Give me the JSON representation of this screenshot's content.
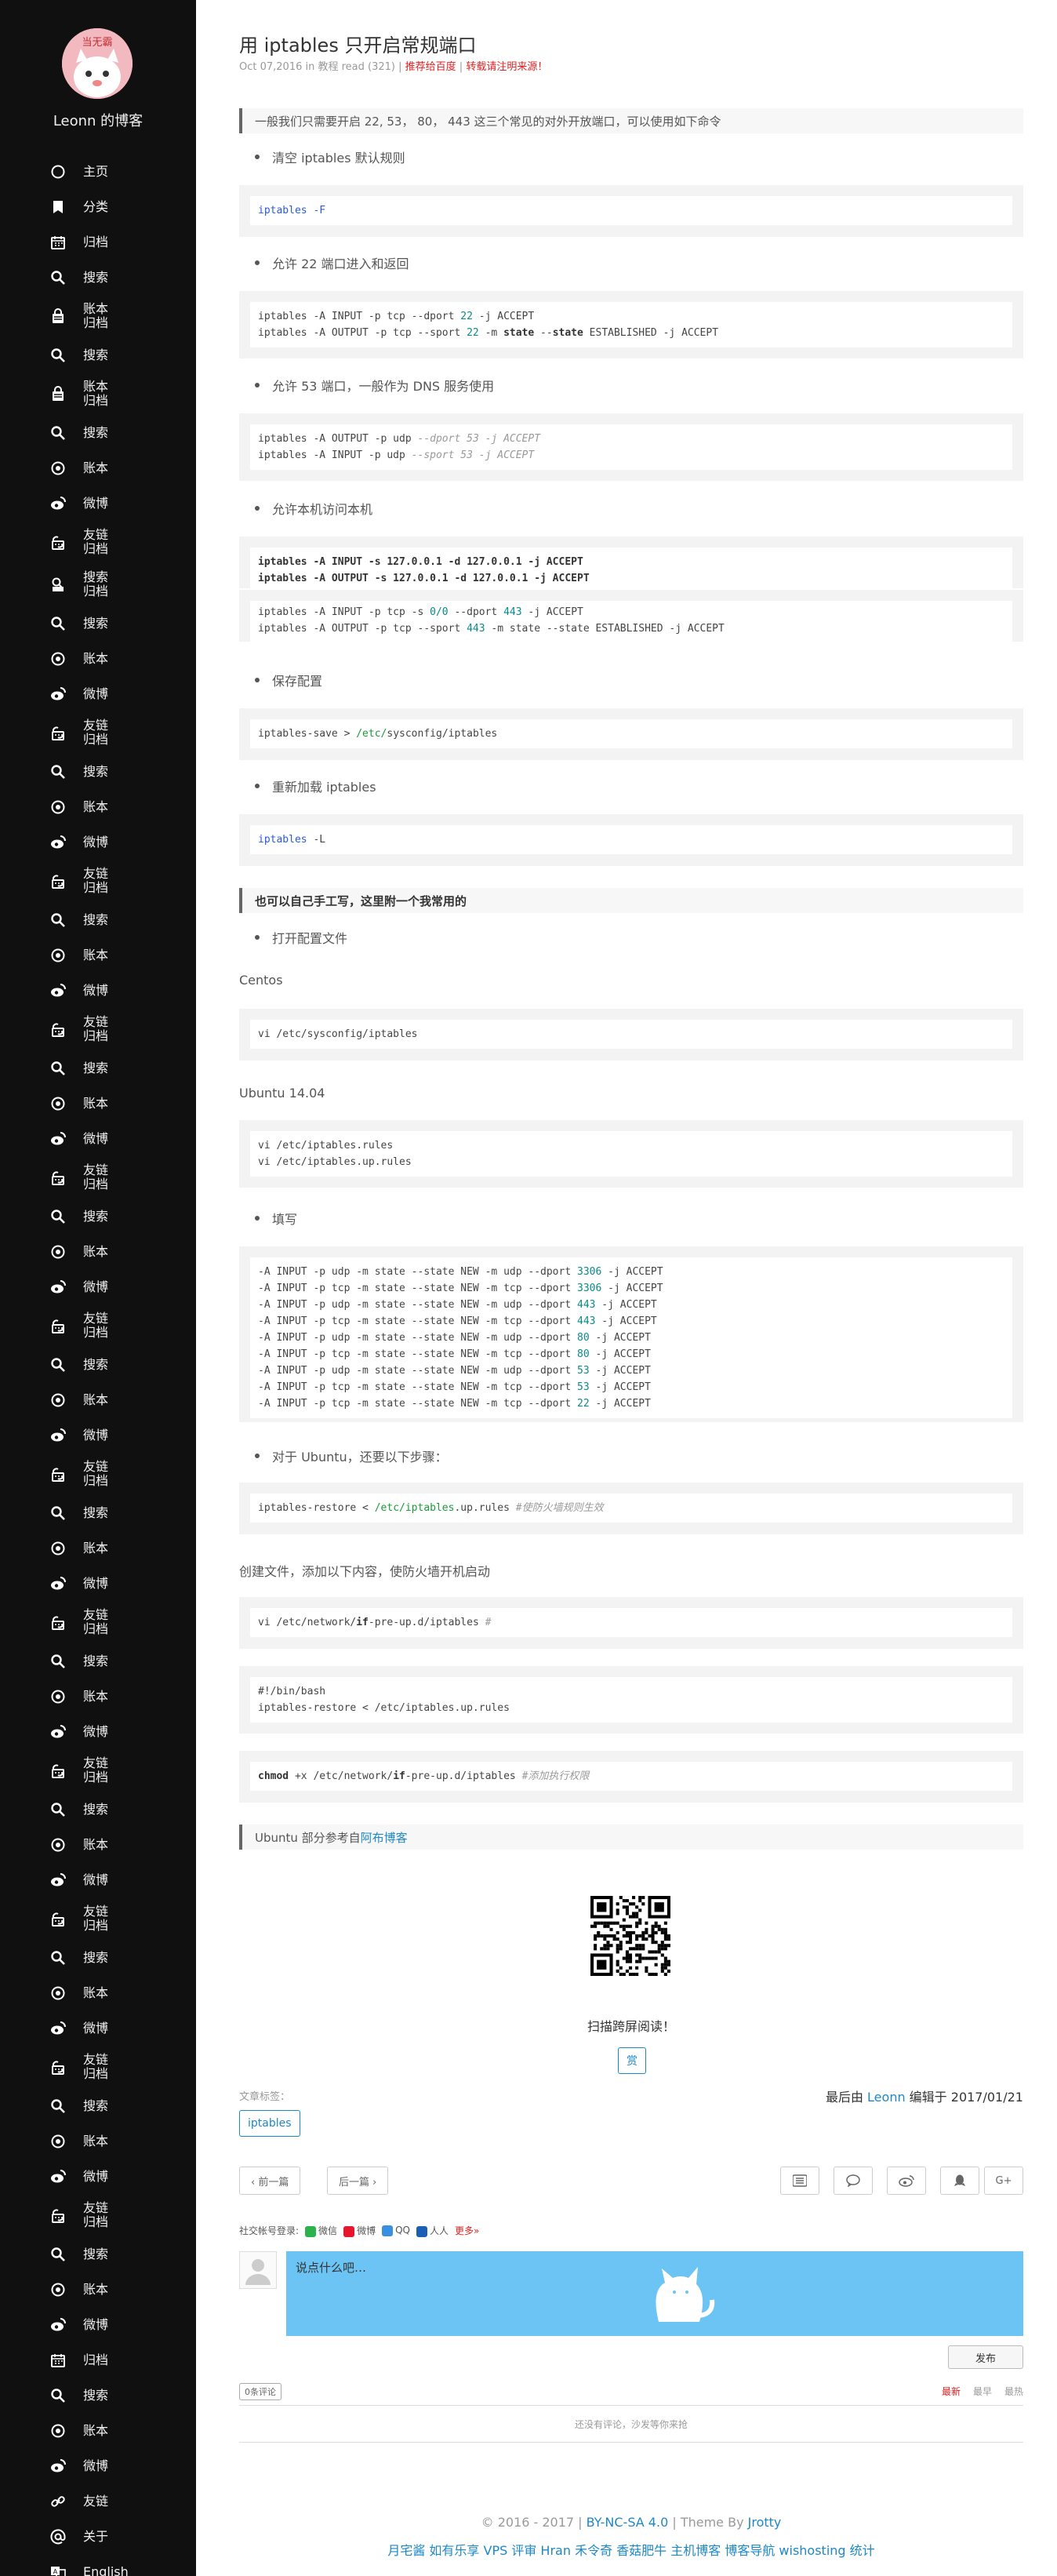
{
  "sidebar": {
    "site_name": "Leonn 的博客",
    "avatar_text": "当无霸",
    "items": [
      {
        "icon": "circle-icon",
        "label": "主页"
      },
      {
        "icon": "bookmark-icon",
        "label": "分类"
      },
      {
        "icon": "calendar-icon",
        "label": "归档"
      },
      {
        "icon": "search-icon",
        "label": "搜索"
      },
      {
        "icon": "lock-calendar-icon",
        "label": "账本\n归档"
      },
      {
        "icon": "search-icon",
        "label": "搜索"
      },
      {
        "icon": "lock-calendar-icon",
        "label": "账本\n归档"
      },
      {
        "icon": "search-icon",
        "label": "搜索"
      },
      {
        "icon": "target-icon",
        "label": "账本"
      },
      {
        "icon": "weibo-icon",
        "label": "微博"
      },
      {
        "icon": "link-calendar-icon",
        "label": "友链\n归档"
      },
      {
        "icon": "search-calendar-icon",
        "label": "搜索\n归档"
      },
      {
        "icon": "search-icon",
        "label": "搜索"
      },
      {
        "icon": "target-icon",
        "label": "账本"
      },
      {
        "icon": "weibo-icon",
        "label": "微博"
      },
      {
        "icon": "link-calendar-icon",
        "label": "友链\n归档"
      },
      {
        "icon": "search-icon",
        "label": "搜索"
      },
      {
        "icon": "target-icon",
        "label": "账本"
      },
      {
        "icon": "weibo-icon",
        "label": "微博"
      },
      {
        "icon": "link-calendar-icon",
        "label": "友链\n归档"
      },
      {
        "icon": "search-icon",
        "label": "搜索"
      },
      {
        "icon": "target-icon",
        "label": "账本"
      },
      {
        "icon": "weibo-icon",
        "label": "微博"
      },
      {
        "icon": "link-calendar-icon",
        "label": "友链\n归档"
      },
      {
        "icon": "search-icon",
        "label": "搜索"
      },
      {
        "icon": "target-icon",
        "label": "账本"
      },
      {
        "icon": "weibo-icon",
        "label": "微博"
      },
      {
        "icon": "link-calendar-icon",
        "label": "友链\n归档"
      },
      {
        "icon": "search-icon",
        "label": "搜索"
      },
      {
        "icon": "target-icon",
        "label": "账本"
      },
      {
        "icon": "weibo-icon",
        "label": "微博"
      },
      {
        "icon": "link-calendar-icon",
        "label": "友链\n归档"
      },
      {
        "icon": "search-icon",
        "label": "搜索"
      },
      {
        "icon": "target-icon",
        "label": "账本"
      },
      {
        "icon": "weibo-icon",
        "label": "微博"
      },
      {
        "icon": "link-calendar-icon",
        "label": "友链\n归档"
      },
      {
        "icon": "search-icon",
        "label": "搜索"
      },
      {
        "icon": "target-icon",
        "label": "账本"
      },
      {
        "icon": "weibo-icon",
        "label": "微博"
      },
      {
        "icon": "link-calendar-icon",
        "label": "友链\n归档"
      },
      {
        "icon": "search-icon",
        "label": "搜索"
      },
      {
        "icon": "target-icon",
        "label": "账本"
      },
      {
        "icon": "weibo-icon",
        "label": "微博"
      },
      {
        "icon": "link-calendar-icon",
        "label": "友链\n归档"
      },
      {
        "icon": "search-icon",
        "label": "搜索"
      },
      {
        "icon": "target-icon",
        "label": "账本"
      },
      {
        "icon": "weibo-icon",
        "label": "微博"
      },
      {
        "icon": "link-calendar-icon",
        "label": "友链\n归档"
      },
      {
        "icon": "search-icon",
        "label": "搜索"
      },
      {
        "icon": "target-icon",
        "label": "账本"
      },
      {
        "icon": "weibo-icon",
        "label": "微博"
      },
      {
        "icon": "link-calendar-icon",
        "label": "友链\n归档"
      },
      {
        "icon": "search-icon",
        "label": "搜索"
      },
      {
        "icon": "target-icon",
        "label": "账本"
      },
      {
        "icon": "weibo-icon",
        "label": "微博"
      },
      {
        "icon": "link-calendar-icon",
        "label": "友链\n归档"
      },
      {
        "icon": "search-icon",
        "label": "搜索"
      },
      {
        "icon": "target-icon",
        "label": "账本"
      },
      {
        "icon": "weibo-icon",
        "label": "微博"
      },
      {
        "icon": "calendar-icon",
        "label": "归档"
      },
      {
        "icon": "search-icon",
        "label": "搜索"
      },
      {
        "icon": "target-icon",
        "label": "账本"
      },
      {
        "icon": "weibo-icon",
        "label": "微博"
      },
      {
        "icon": "link-icon",
        "label": "友链"
      },
      {
        "icon": "at-icon",
        "label": "关于"
      },
      {
        "icon": "language-icon",
        "label": "English"
      }
    ]
  },
  "post": {
    "title": "用 iptables 只开启常规端口",
    "meta_date": "Oct 07,2016 in 教程 read (321)",
    "meta_sep": " | ",
    "meta_baidu": "推荐给百度",
    "meta_sep2": " | ",
    "meta_source": "转载请注明来源！",
    "intro": "一般我们只需要开启 22, 53， 80， 443 这三个常见的对外开放端口，可以使用如下命令",
    "b1": "清空 iptables 默认规则",
    "c1": "iptables -F",
    "b2": "允许 22 端口进入和返回",
    "c2a": "iptables -A INPUT -p tcp --dport ",
    "c2a_num": "22",
    "c2a_end": " -j ACCEPT",
    "c2b": "iptables -A OUTPUT -p tcp --sport ",
    "c2b_num": "22",
    "c2b_mid": " -m ",
    "c2b_kw1": "state",
    "c2b_mid2": " --",
    "c2b_kw2": "state",
    "c2b_end": " ESTABLISHED -j ACCEPT",
    "b3": "允许 53 端口，一般作为 DNS 服务使用",
    "c3a": "iptables -A OUTPUT -p udp ",
    "c3a_cm": "--dport 53 -j ACCEPT",
    "c3b": "iptables -A INPUT -p udp ",
    "c3b_cm": "--sport 53 -j ACCEPT",
    "b4": "允许本机访问本机",
    "c4a": "iptables -A INPUT -s 127.0.0.1 -d 127.0.0.1 -j ACCEPT",
    "c4b": "iptables -A OUTPUT -s 127.0.0.1 -d 127.0.0.1 -j ACCEPT",
    "c5a": "iptables -A INPUT -p tcp -s ",
    "c5a_num": "0/0",
    "c5a_mid": " --dport ",
    "c5a_num2": "443",
    "c5a_end": " -j ACCEPT",
    "c5b": "iptables -A OUTPUT -p tcp --sport ",
    "c5b_num": "443",
    "c5b_mid": " -m state --state ESTABLISHED -j ACCEPT",
    "b5": "保存配置",
    "c6a": "iptables-save > ",
    "c6a_grn": "/etc/",
    "c6a_end": "sysconfig/iptables",
    "b6": "重新加载 iptables",
    "c7a": "iptables",
    "c7a_end": " -L",
    "quote2": "也可以自己手工写，这里附一个我常用的",
    "b7": "打开配置文件",
    "centos": "Centos",
    "c8": "vi /etc/sysconfig/iptables",
    "ubuntu": "Ubuntu 14.04",
    "c9a": "vi /etc/iptables.rules",
    "c9b": "vi /etc/iptables.up.rules",
    "b8": "填写",
    "rules": [
      {
        "pre": "-A INPUT -p udp -m state --state NEW -m udp --dport ",
        "num": "3306",
        "end": " -j ACCEPT"
      },
      {
        "pre": "-A INPUT -p tcp -m state --state NEW -m tcp --dport ",
        "num": "3306",
        "end": " -j ACCEPT"
      },
      {
        "pre": "-A INPUT -p udp -m state --state NEW -m udp --dport ",
        "num": "443",
        "end": " -j ACCEPT"
      },
      {
        "pre": "-A INPUT -p tcp -m state --state NEW -m tcp --dport ",
        "num": "443",
        "end": " -j ACCEPT"
      },
      {
        "pre": "-A INPUT -p udp -m state --state NEW -m udp --dport ",
        "num": "80",
        "end": " -j ACCEPT"
      },
      {
        "pre": "-A INPUT -p tcp -m state --state NEW -m tcp --dport ",
        "num": "80",
        "end": " -j ACCEPT"
      },
      {
        "pre": "-A INPUT -p udp -m state --state NEW -m udp --dport ",
        "num": "53",
        "end": " -j ACCEPT"
      },
      {
        "pre": "-A INPUT -p tcp -m state --state NEW -m tcp --dport ",
        "num": "53",
        "end": " -j ACCEPT"
      },
      {
        "pre": "-A INPUT -p tcp -m state --state NEW -m tcp --dport ",
        "num": "22",
        "end": " -j ACCEPT"
      }
    ],
    "b9": "对于 Ubuntu，还要以下步骤：",
    "c10a": "iptables-restore < ",
    "c10a_grn": "/etc/iptables",
    "c10a_mid": ".up.rules ",
    "c10a_cm": "#使防火墙规则生效",
    "para2": "创建文件，添加以下内容，使防火墙开机启动",
    "c11a": "vi /etc/network/",
    "c11a_kw": "if",
    "c11a_end": "-pre-up.d/iptables ",
    "c11a_cm": "#",
    "c12a": "#!/bin/bash",
    "c12b": "iptables-restore < /etc/iptables.up.rules",
    "c13_kw": "chmod",
    "c13a": " +x /etc/network/",
    "c13_kw2": "if",
    "c13b": "-pre-up.d/iptables ",
    "c13_cm": "#添加执行权限",
    "quote3_pre": "Ubuntu 部分参考自",
    "quote3_link": "阿布博客",
    "scan": "扫描跨屏阅读！",
    "reward": "赏",
    "tags_label": "文章标签：",
    "tag": "iptables",
    "edited_pre": "最后由 ",
    "edited_who": "Leonn",
    "edited_post": " 编辑于 2017/01/21"
  },
  "pager": {
    "prev": "‹ 前一篇",
    "next": "后一篇 ›"
  },
  "share": {
    "gplus": "G+"
  },
  "social": {
    "label": "社交帐号登录:",
    "wechat": "微信",
    "weibo": "微博",
    "qq": "QQ",
    "renren": "人人",
    "more": "更多»"
  },
  "comment": {
    "placeholder": "说点什么吧…",
    "publish": "发布",
    "count": "0条评论",
    "sort_new": "最新",
    "sort_old": "最早",
    "sort_hot": "最热",
    "empty": "还没有评论，沙发等你来抢"
  },
  "footer": {
    "line1_pre": "© 2016 - 2017 | ",
    "license": "BY-NC-SA 4.0",
    "line1_mid": " | Theme By ",
    "theme": "Jrotty",
    "links": "月宅酱 如有乐享 VPS 评审 Hran 禾令奇 香菇肥牛 主机博客 博客导航 wishosting 统计"
  },
  "colors": {
    "accent": "#1e88c7",
    "red": "#e02020",
    "sidebar_bg": "#101010",
    "comment_bg": "#6cc4f4"
  }
}
